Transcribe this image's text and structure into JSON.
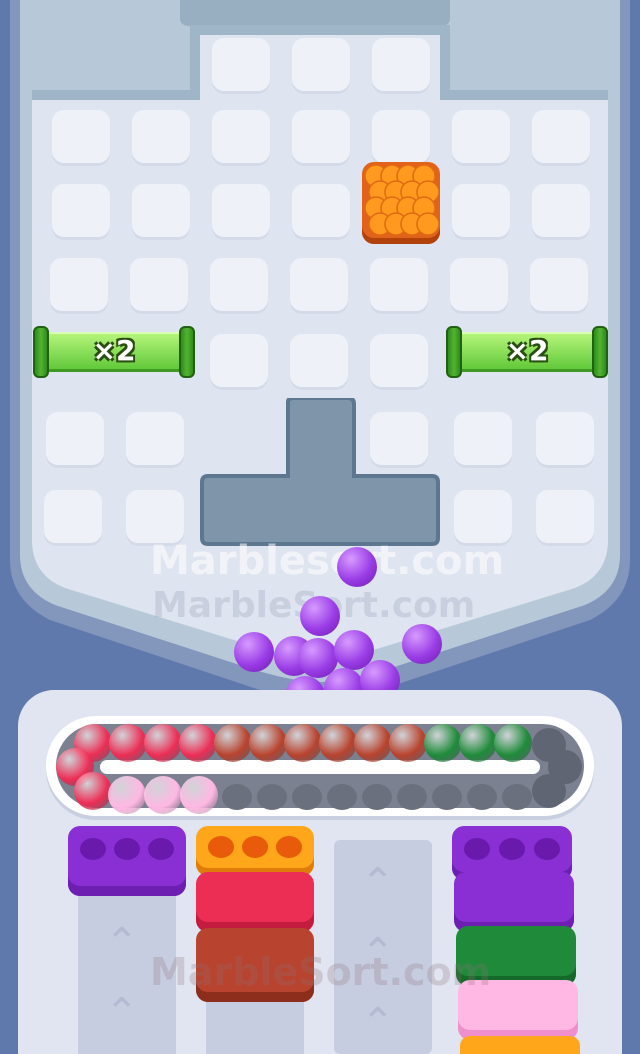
{
  "board": {
    "multiplier_left": "×2",
    "multiplier_right": "×2",
    "colors": {
      "bg_outer": "#5f79ad",
      "frame": "#b7c8d8",
      "tile": "#eef1f8",
      "well": "#7e95aa"
    },
    "orange_block": {
      "color": "orange",
      "row": 2,
      "col": 5
    }
  },
  "watermark": {
    "primary": "Marblesort.com",
    "secondary": "MarbleSort.com",
    "lower": "MarbleSort.com"
  },
  "falling_marbles": {
    "color": "purple",
    "count": 10
  },
  "conveyor": {
    "marbles": [
      "red",
      "red",
      "red",
      "red",
      "red",
      "brown",
      "brown",
      "brown",
      "brown",
      "brown",
      "brown",
      "green",
      "green",
      "green",
      "pink",
      "pink",
      "pink"
    ],
    "empty_slots": 12
  },
  "bins": [
    {
      "id": "bin-1",
      "lid": "purple",
      "stack": []
    },
    {
      "id": "bin-2",
      "lid": "orange",
      "stack": [
        "red",
        "brown"
      ]
    },
    {
      "id": "bin-3",
      "lid": "empty",
      "stack": []
    },
    {
      "id": "bin-4",
      "lid": "purple",
      "stack": [
        "purple",
        "green",
        "pink",
        "orange"
      ]
    }
  ],
  "palette": {
    "purple": "#9a3ce6",
    "orange": "#ff8c1a",
    "red": "#ec2e55",
    "brown": "#b8432e",
    "green": "#1f8b3a",
    "pink": "#ffb7e3"
  }
}
